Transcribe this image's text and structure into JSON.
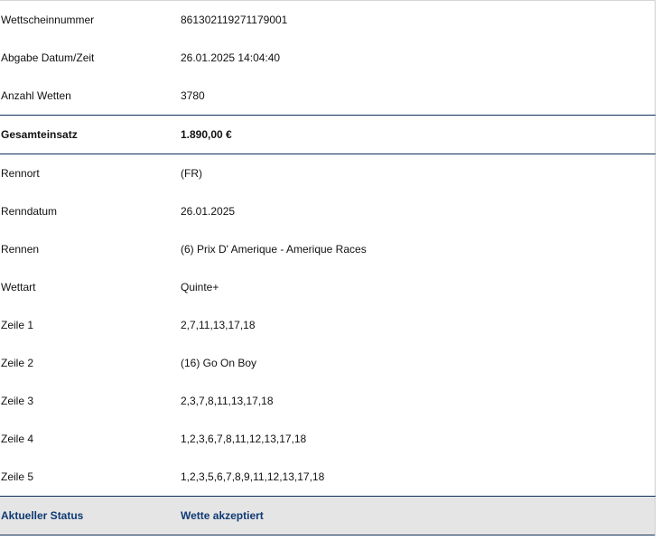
{
  "details": {
    "rows": [
      {
        "label": "Wettscheinnummer",
        "value": "861302119271179001"
      },
      {
        "label": "Abgabe Datum/Zeit",
        "value": "26.01.2025 14:04:40"
      },
      {
        "label": "Anzahl Wetten",
        "value": "3780"
      }
    ],
    "total": {
      "label": "Gesamteinsatz",
      "value": "1.890,00 €"
    },
    "race_rows": [
      {
        "label": "Rennort",
        "value": "(FR)"
      },
      {
        "label": "Renndatum",
        "value": "26.01.2025"
      },
      {
        "label": "Rennen",
        "value": "(6) Prix D' Amerique - Amerique Races"
      },
      {
        "label": "Wettart",
        "value": "Quinte+"
      },
      {
        "label": "Zeile 1",
        "value": "2,7,11,13,17,18"
      },
      {
        "label": "Zeile 2",
        "value": "(16) Go On Boy"
      },
      {
        "label": "Zeile 3",
        "value": "2,3,7,8,11,13,17,18"
      },
      {
        "label": "Zeile 4",
        "value": "1,2,3,6,7,8,11,12,13,17,18"
      },
      {
        "label": "Zeile 5",
        "value": "1,2,3,5,6,7,8,9,11,12,13,17,18"
      }
    ],
    "status": {
      "label": "Aktueller Status",
      "value": "Wette akzeptiert"
    }
  },
  "colors": {
    "divider": "#0f2f57",
    "status_text": "#0f3a73",
    "status_bg": "#e5e5e5"
  }
}
